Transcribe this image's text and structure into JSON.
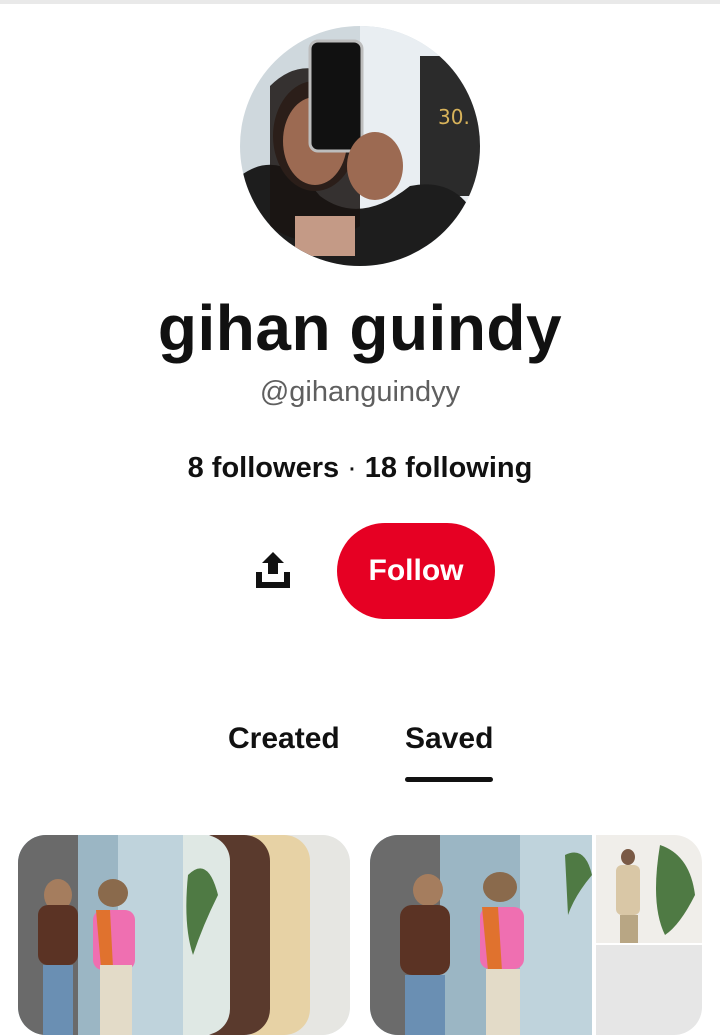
{
  "profile": {
    "name": "gihan guindy",
    "handle": "@gihanguindyy",
    "followers_text": "8 followers",
    "separator": "·",
    "following_text": "18 following"
  },
  "actions": {
    "follow_label": "Follow",
    "share_icon": "share-icon"
  },
  "tabs": [
    {
      "label": "Created",
      "selected": false
    },
    {
      "label": "Saved",
      "selected": true
    }
  ],
  "colors": {
    "accent": "#e60023",
    "muted_text": "#5f5f5f",
    "text": "#111111"
  }
}
